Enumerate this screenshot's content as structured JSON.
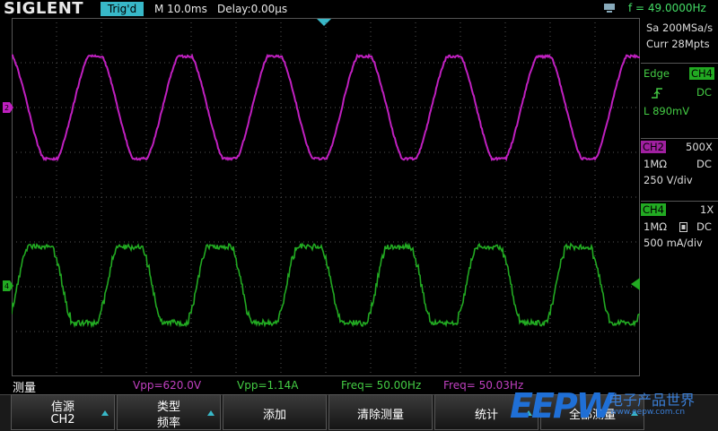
{
  "header": {
    "brand": "SIGLENT",
    "trig_status": "Trig'd",
    "timebase": "M 10.0ms",
    "delay": "Delay:0.00µs",
    "frequency": "f = 49.0000Hz"
  },
  "acquisition": {
    "sample_rate": "Sa 200MSa/s",
    "memory": "Curr 28Mpts"
  },
  "trigger": {
    "type": "Edge",
    "source": "CH4",
    "coupling": "DC",
    "level": "L  890mV"
  },
  "ch2": {
    "name": "CH2",
    "probe": "500X",
    "impedance": "1MΩ",
    "coupling": "DC",
    "scale": "250 V/div",
    "color": "#c020c0"
  },
  "ch4": {
    "name": "CH4",
    "probe": "1X",
    "impedance": "1MΩ",
    "coupling": "DC",
    "scale": "500 mA/div",
    "color": "#22aa22"
  },
  "measurements": {
    "title": "测量",
    "items": [
      {
        "text": "Vpp=620.0V",
        "color": "#c040c0"
      },
      {
        "text": "Vpp=1.14A",
        "color": "#44cc44"
      },
      {
        "text": "Freq= 50.00Hz",
        "color": "#44cc44"
      },
      {
        "text": "Freq= 50.03Hz",
        "color": "#c040c0"
      }
    ]
  },
  "menu": {
    "btn1_l1": "信源",
    "btn1_l2": "CH2",
    "btn2_l1": "类型",
    "btn2_l2": "频率",
    "btn3": "添加",
    "btn4": "清除测量",
    "btn5": "统计",
    "btn6": "全部测量"
  },
  "watermark": {
    "logo": "EEPW",
    "cn": "电子产品世界",
    "url": "www.eepw.com.cn"
  },
  "chart_data": {
    "type": "line",
    "series": [
      {
        "name": "CH2",
        "frequency_hz": 50.03,
        "vpp": 620.0,
        "color": "#c020c0"
      },
      {
        "name": "CH4",
        "frequency_hz": 50.0,
        "vpp": 1.14,
        "color": "#22aa22"
      }
    ],
    "x_divisions": 14,
    "y_divisions": 8,
    "time_per_div_ms": 10.0,
    "grid": true
  }
}
